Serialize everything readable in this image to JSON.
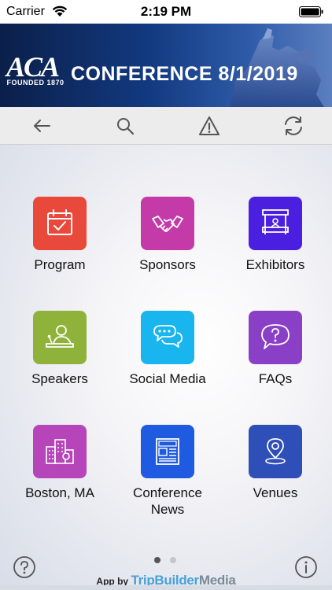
{
  "status": {
    "carrier": "Carrier",
    "time": "2:19 PM"
  },
  "banner": {
    "logo_text": "ACA",
    "founded": "FOUNDED 1870",
    "title": "CONFERENCE  8/1/2019"
  },
  "toolbar": {
    "icons": [
      "back-arrow-icon",
      "search-icon",
      "alert-icon",
      "refresh-icon"
    ]
  },
  "tiles": [
    {
      "label": "Program",
      "color": "#e9493b",
      "icon": "calendar-check-icon"
    },
    {
      "label": "Sponsors",
      "color": "#c43aa8",
      "icon": "handshake-icon"
    },
    {
      "label": "Exhibitors",
      "color": "#4b1fe0",
      "icon": "booth-icon"
    },
    {
      "label": "Speakers",
      "color": "#8fb33a",
      "icon": "speaker-podium-icon"
    },
    {
      "label": "Social Media",
      "color": "#18b5ef",
      "icon": "chat-bubbles-icon"
    },
    {
      "label": "FAQs",
      "color": "#8a3fc7",
      "icon": "question-bubble-icon"
    },
    {
      "label": "Boston, MA",
      "color": "#b545b8",
      "icon": "city-buildings-icon"
    },
    {
      "label": "Conference\nNews",
      "color": "#1f5be0",
      "icon": "newspaper-icon"
    },
    {
      "label": "Venues",
      "color": "#2f4fb8",
      "icon": "map-pin-icon"
    }
  ],
  "pager": {
    "pages": 2,
    "current": 1
  },
  "footer": {
    "app_by": "App by",
    "brand_1": "TripBuilder",
    "brand_2": "Media"
  }
}
